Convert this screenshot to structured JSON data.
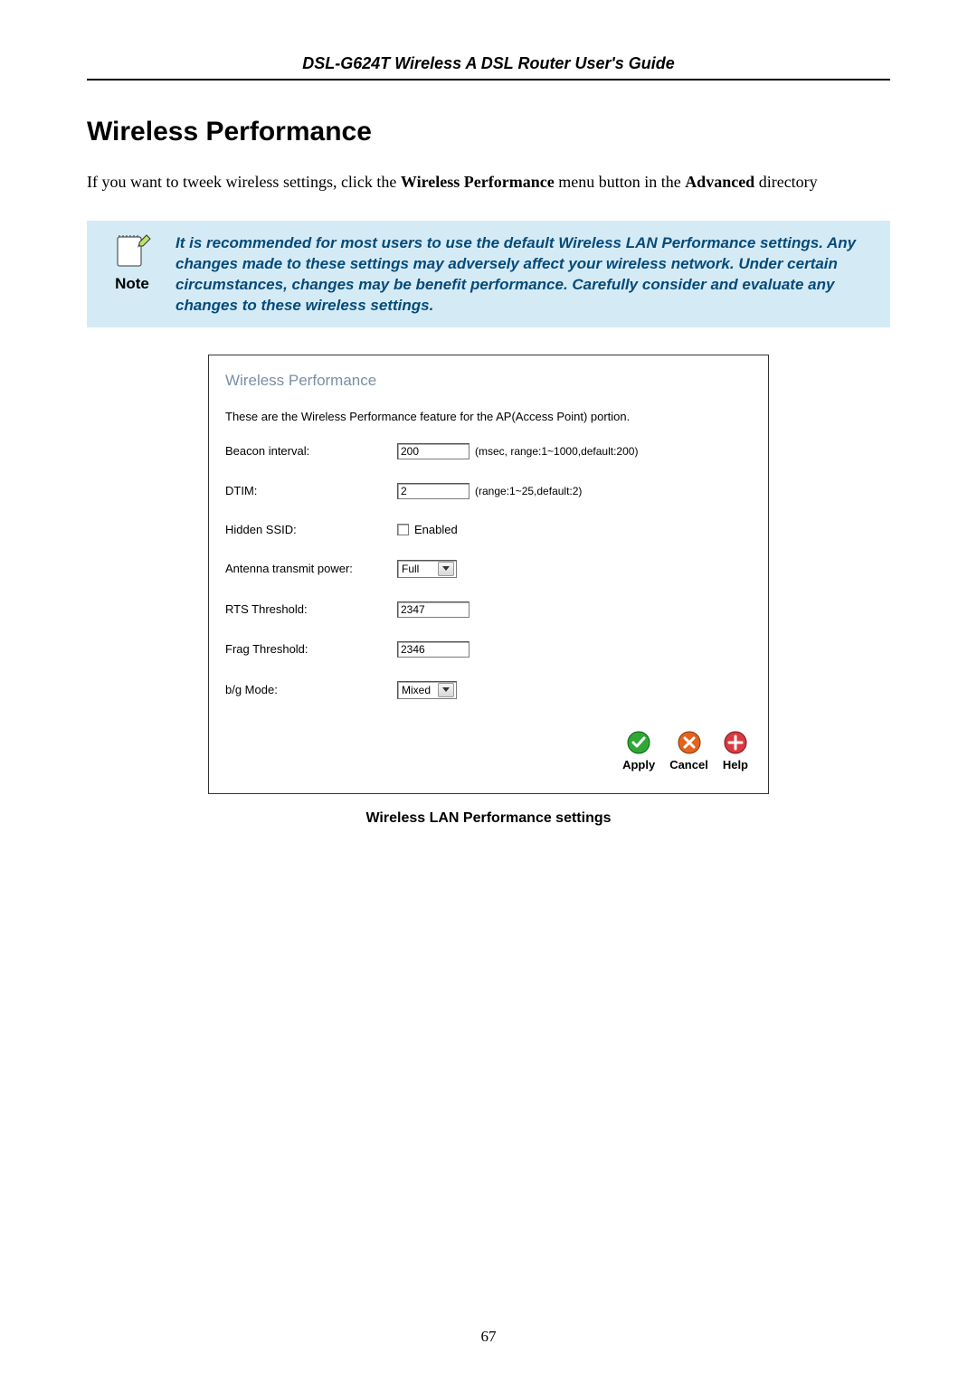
{
  "header": {
    "running": "DSL-G624T Wireless A DSL Router User's Guide"
  },
  "section": {
    "title": "Wireless Performance",
    "intro_pre": "If you want to tweek wireless settings, click the ",
    "intro_b1": "Wireless Performance",
    "intro_mid": " menu button in the ",
    "intro_b2": "Advanced",
    "intro_post": " directory"
  },
  "note": {
    "label": "Note",
    "text": "It is recommended for most users to use the default Wireless LAN Performance settings. Any changes made to these settings may adversely affect your wireless network. Under certain circumstances, changes may be benefit performance. Carefully consider and evaluate any changes to these wireless settings."
  },
  "panel": {
    "title": "Wireless Performance",
    "desc": "These are the Wireless Performance feature for the AP(Access Point) portion.",
    "rows": {
      "beacon": {
        "label": "Beacon interval:",
        "value": "200",
        "hint": "(msec, range:1~1000,default:200)"
      },
      "dtim": {
        "label": "DTIM:",
        "value": "2",
        "hint": "(range:1~25,default:2)"
      },
      "hidden_ssid": {
        "label": "Hidden SSID:",
        "checkbox_label": "Enabled"
      },
      "antenna": {
        "label": "Antenna transmit power:",
        "value": "Full"
      },
      "rts": {
        "label": "RTS Threshold:",
        "value": "2347"
      },
      "frag": {
        "label": "Frag Threshold:",
        "value": "2346"
      },
      "mode": {
        "label": "b/g Mode:",
        "value": "Mixed"
      }
    },
    "buttons": {
      "apply": "Apply",
      "cancel": "Cancel",
      "help": "Help"
    }
  },
  "figure_caption": "Wireless LAN Performance settings",
  "page_number": "67",
  "colors": {
    "note_bg": "#d4ebf6",
    "note_text": "#064a78",
    "apply": "#2fa836",
    "cancel": "#e1641f",
    "help": "#d93a3f"
  }
}
